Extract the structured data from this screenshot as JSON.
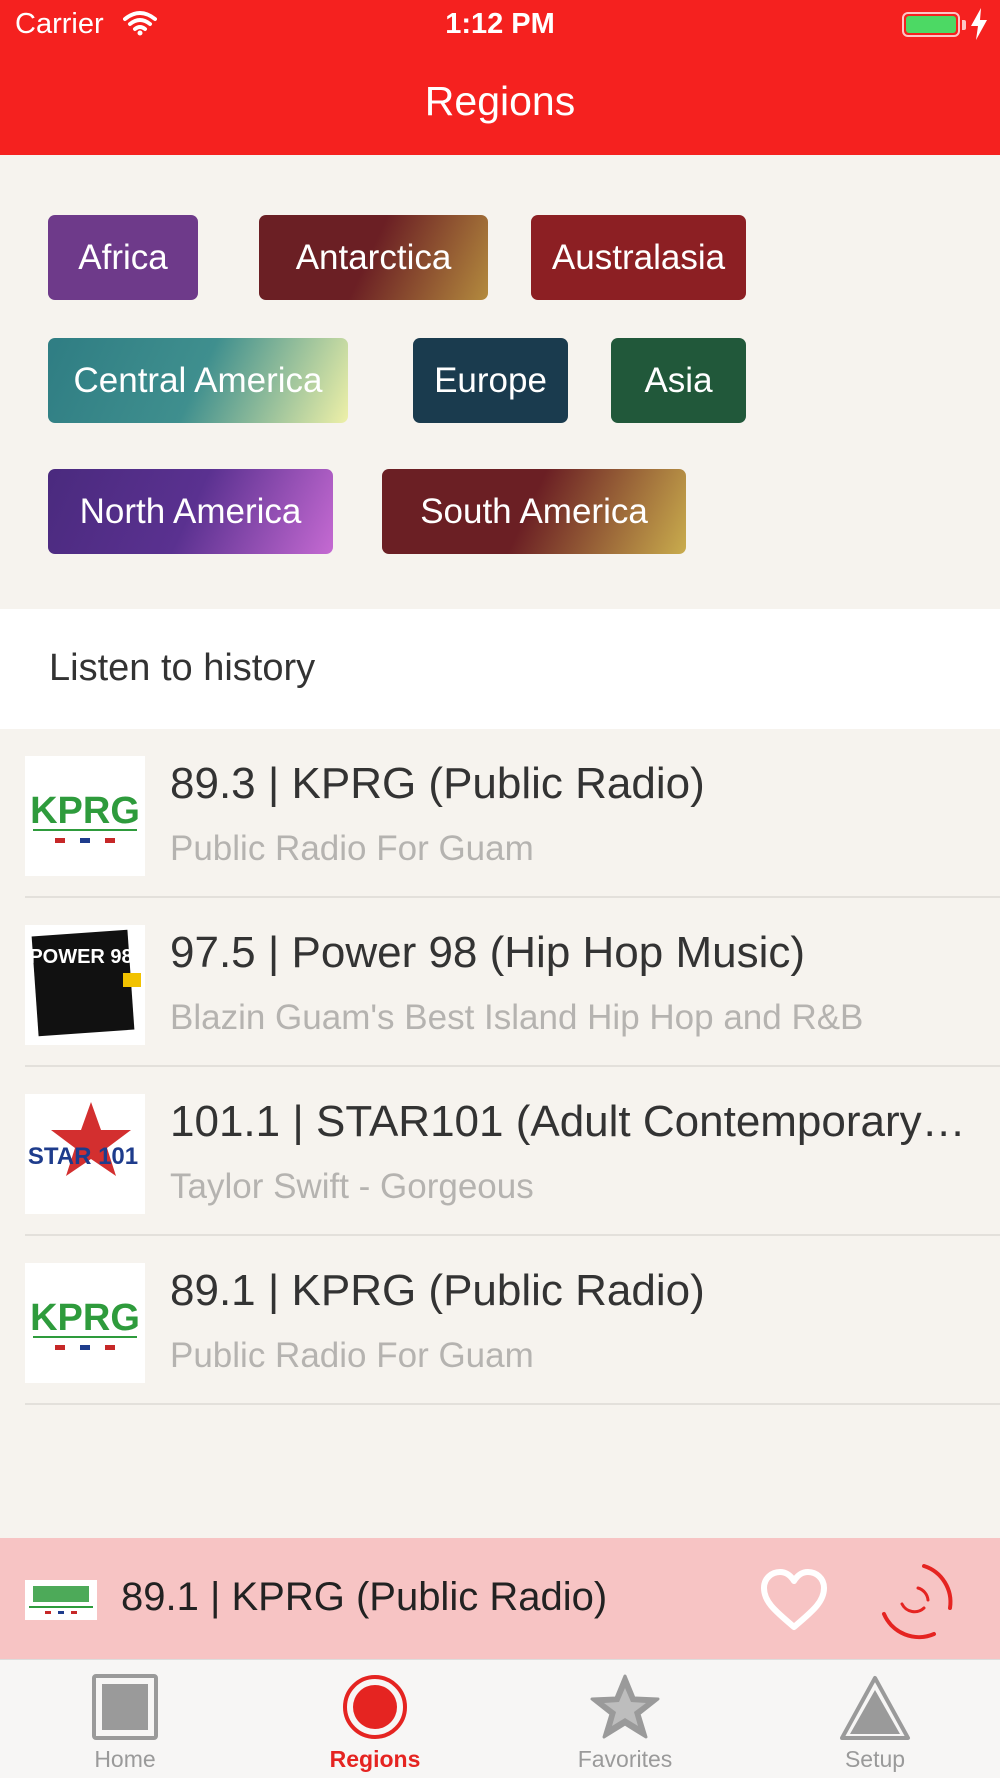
{
  "status_bar": {
    "carrier": "Carrier",
    "time": "1:12 PM"
  },
  "nav": {
    "title": "Regions"
  },
  "regions": [
    {
      "label": "Africa"
    },
    {
      "label": "Antarctica"
    },
    {
      "label": "Australasia"
    },
    {
      "label": "Central America"
    },
    {
      "label": "Europe"
    },
    {
      "label": "Asia"
    },
    {
      "label": "North America"
    },
    {
      "label": "South America"
    }
  ],
  "history": {
    "title": "Listen to history",
    "items": [
      {
        "title": "89.3 | KPRG (Public Radio)",
        "subtitle": "Public Radio For Guam",
        "logo": "KPRG"
      },
      {
        "title": "97.5 | Power 98 (Hip Hop Music)",
        "subtitle": "Blazin Guam's Best Island Hip Hop and R&B",
        "logo": "POWER 98"
      },
      {
        "title": "101.1 | STAR101 (Adult Contemporary…",
        "subtitle": "Taylor Swift - Gorgeous",
        "logo": "STAR 101"
      },
      {
        "title": "89.1 | KPRG (Public Radio)",
        "subtitle": "Public Radio For Guam",
        "logo": "KPRG"
      }
    ]
  },
  "player": {
    "title": "89.1 | KPRG (Public Radio)"
  },
  "tabs": [
    {
      "label": "Home"
    },
    {
      "label": "Regions"
    },
    {
      "label": "Favorites"
    },
    {
      "label": "Setup"
    }
  ],
  "colors": {
    "accent": "#f5211f",
    "player_bg": "#f7c4c4",
    "tab_active": "#e52421",
    "background": "#f6f3ee"
  }
}
